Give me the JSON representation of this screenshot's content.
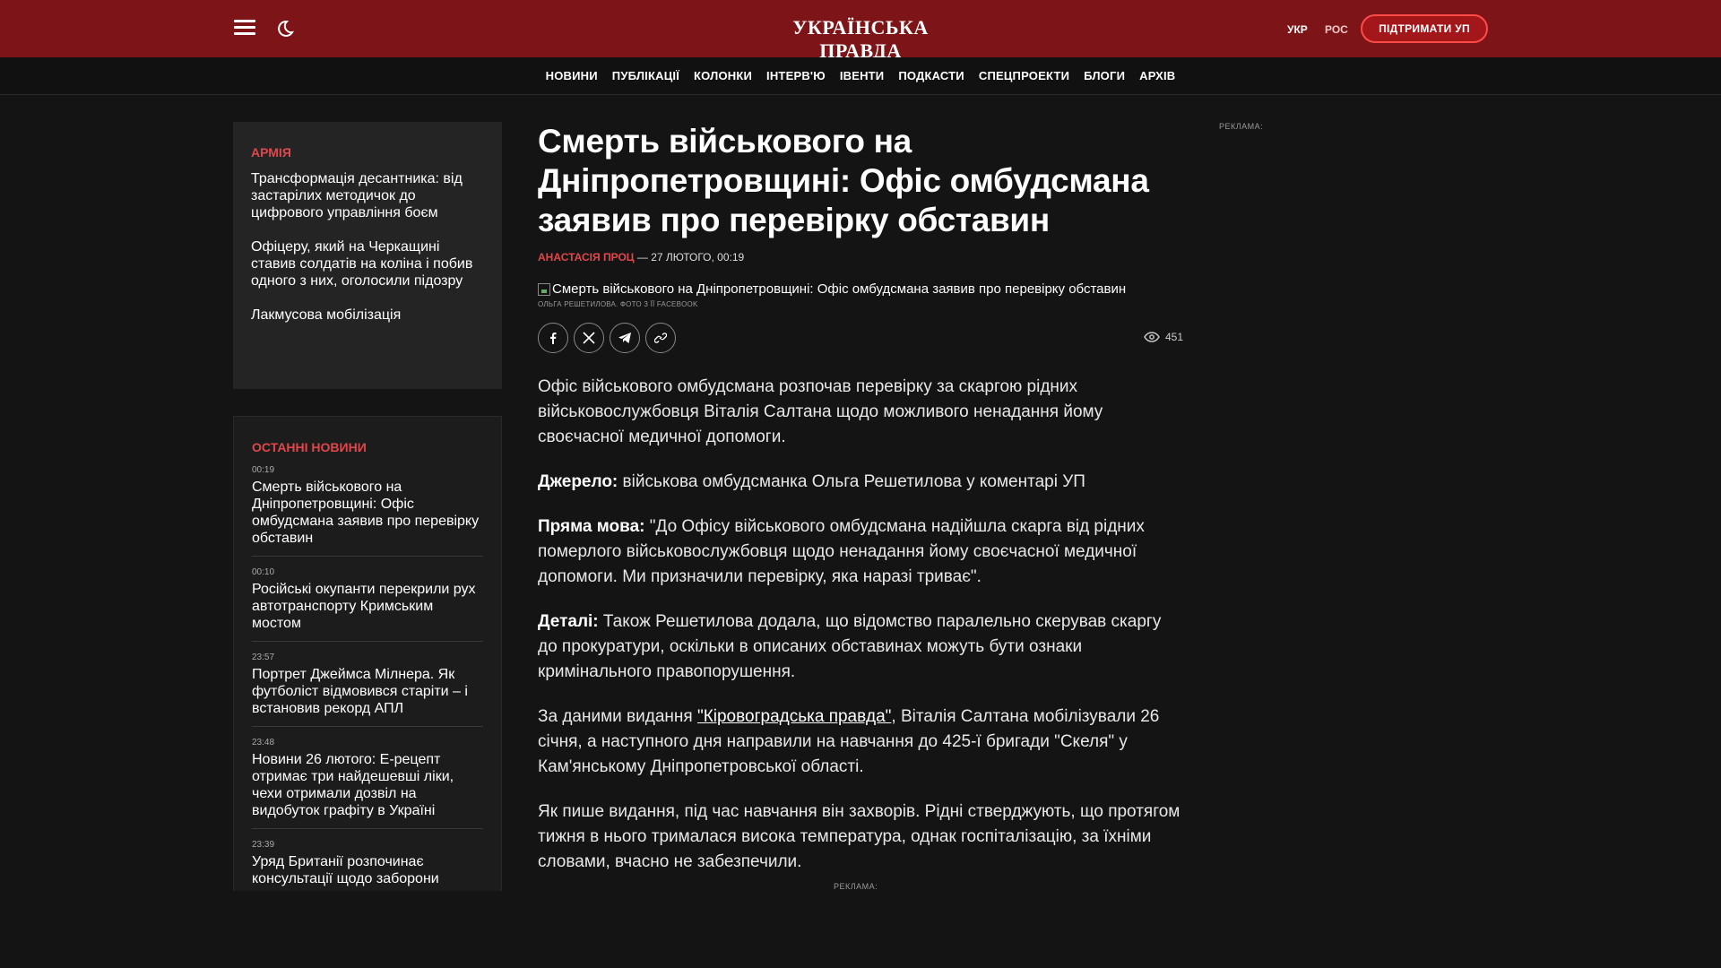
{
  "header": {
    "logo": "УКРАЇНСЬКА ПРАВДА",
    "lang_ukr": "УКР",
    "lang_ros": "РОС",
    "support_label": "ПІДТРИМАТИ УП",
    "brand_color": "#7d1518"
  },
  "nav": [
    "НОВИНИ",
    "ПУБЛІКАЦІЇ",
    "КОЛОНКИ",
    "ІНТЕРВ'Ю",
    "ІВЕНТИ",
    "ПОДКАСТИ",
    "СПЕЦПРОЕКТИ",
    "БЛОГИ",
    "АРХІВ"
  ],
  "army": {
    "tag": "АРМІЯ",
    "items": [
      "Трансформація десантника: від застарілих методичок до цифрового управління боєм",
      "Офіцеру, який на Черкащині ставив солдатів на коліна і побив одного з них, оголосили підозру",
      "Лакмусова мобілізація"
    ]
  },
  "latest": {
    "title": "ОСТАННІ НОВИНИ",
    "items": [
      {
        "time": "00:19",
        "title": "Смерть військового на Дніпропетровщині: Офіс омбудсмана заявив про перевірку обставин"
      },
      {
        "time": "00:10",
        "title": "Російські окупанти перекрили рух автотранспорту Кримським мостом"
      },
      {
        "time": "23:57",
        "title": "Портрет Джеймса Мілнера. Як футболіст відмовився старіти – і встановив рекорд АПЛ"
      },
      {
        "time": "23:48",
        "title": "Новини 26 лютого: Е-рецепт отримає три найдешевші ліки, чехи отримали дозвіл на видобуток графіту в Україні"
      },
      {
        "time": "23:39",
        "title": "Уряд Британії розпочинає консультації щодо заборони"
      }
    ]
  },
  "article": {
    "title": "Смерть військового на Дніпропетровщині: Офіс омбудсмана заявив про перевірку обставин",
    "author": "АНАСТАСІЯ ПРОЦ",
    "date": "— 27 ЛЮТОГО, 00:19",
    "image_alt": "Смерть військового на Дніпропетровщині: Офіс омбудсмана заявив про перевірку обставин",
    "caption": "ОЛЬГА РЕШЕТИЛОВА. ФОТО З ЇЇ FACEBOOK",
    "views": "451",
    "p1": "Офіс військового омбудсмана розпочав перевірку за скаргою рідних військовослужбовця Віталія Салтана щодо можливого ненадання йому своєчасної медичної допомоги.",
    "p2_label": "Джерело:",
    "p2": " військова омбудсманка Ольга Решетилова у коментарі УП",
    "p3_label": "Пряма мова:",
    "p3": " \"До Офісу військового омбудсмана надійшла скарга від рідних померлого військовослужбовця щодо ненадання йому своєчасної медичної допомоги. Ми призначили перевірку, яка наразі триває\".",
    "p4_label": "Деталі:",
    "p4": " Також Решетилова додала, що відомство паралельно скерував скаргу до прокуратури, оскільки в описаних обставинах можуть бути ознаки кримінального правопорушення.",
    "p5_a": "За даними видання ",
    "p5_link": "\"Кіровоградська правда\"",
    "p5_b": ", Віталія Салтана мобілізували 26 січня, а наступного дня направили на навчання до 425-ї бригади \"Скеля\" у Кам'янському Дніпропетровської області.",
    "p6": "Як пише видання, під час навчання він захворів. Рідні стверджують, що протягом тижня в нього трималася висока температура, однак госпіталізацію, за їхніми словами, вчасно не забезпечили."
  },
  "ads": {
    "right": "РЕКЛАМА:",
    "bottom": "РЕКЛАМА:"
  }
}
